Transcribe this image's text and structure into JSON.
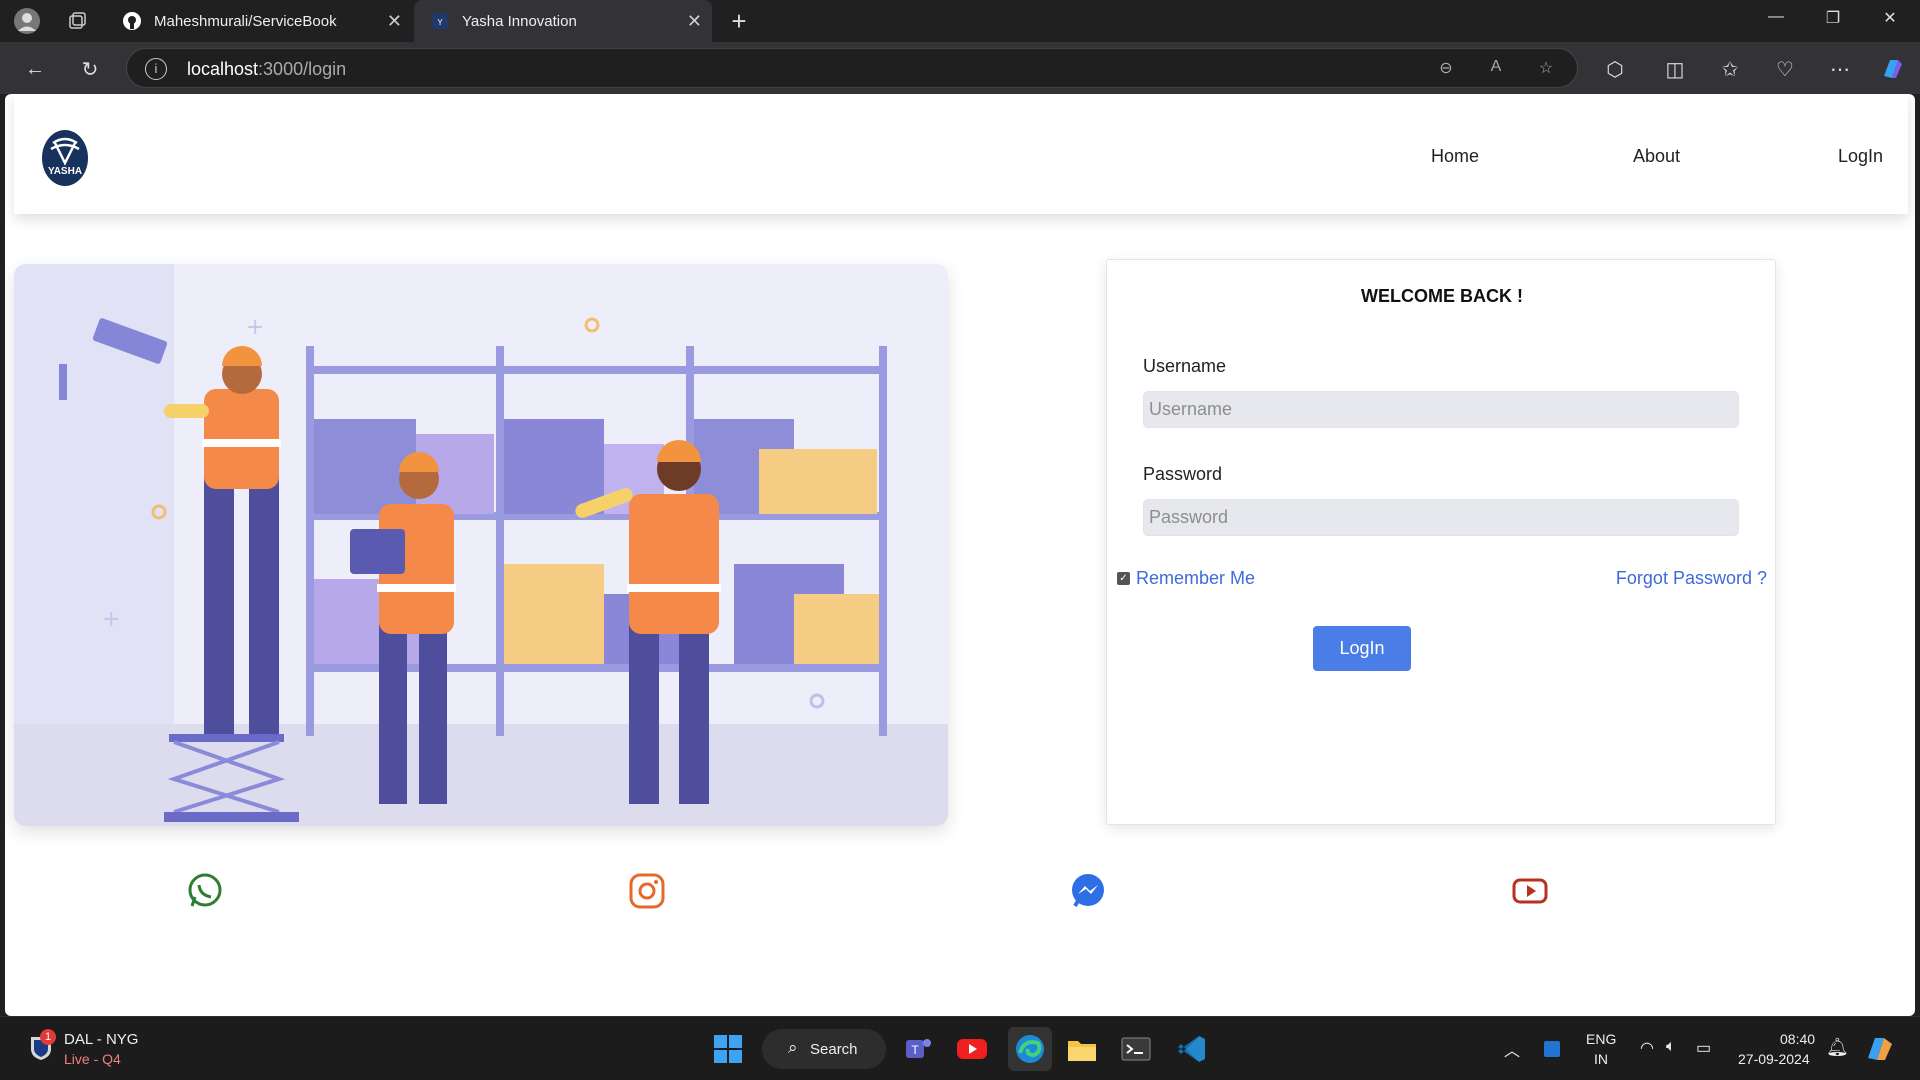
{
  "browser": {
    "tabs": [
      {
        "title": "Maheshmurali/ServiceBook",
        "favicon": "github-icon",
        "active": false
      },
      {
        "title": "Yasha Innovation",
        "favicon": "yasha-icon",
        "active": true
      }
    ],
    "new_tab": "+",
    "url_host": "localhost",
    "url_path": ":3000/login"
  },
  "navbar": {
    "logo_text": "YASHA",
    "links": [
      "Home",
      "About",
      "LogIn"
    ]
  },
  "login": {
    "heading": "WELCOME BACK !",
    "username_label": "Username",
    "username_placeholder": "Username",
    "password_label": "Password",
    "password_placeholder": "Password",
    "remember_label": "Remember Me",
    "remember_checked": true,
    "forgot_label": "Forgot Password ?",
    "submit_label": "LogIn",
    "accent_color": "#4a7de6"
  },
  "social": [
    "whatsapp-icon",
    "instagram-icon",
    "messenger-icon",
    "youtube-icon"
  ],
  "taskbar": {
    "widget_badge": "1",
    "widget_title": "DAL - NYG",
    "widget_sub": "Live - Q4",
    "search_label": "Search",
    "lang_top": "ENG",
    "lang_bottom": "IN",
    "time": "08:40",
    "date": "27-09-2024"
  }
}
